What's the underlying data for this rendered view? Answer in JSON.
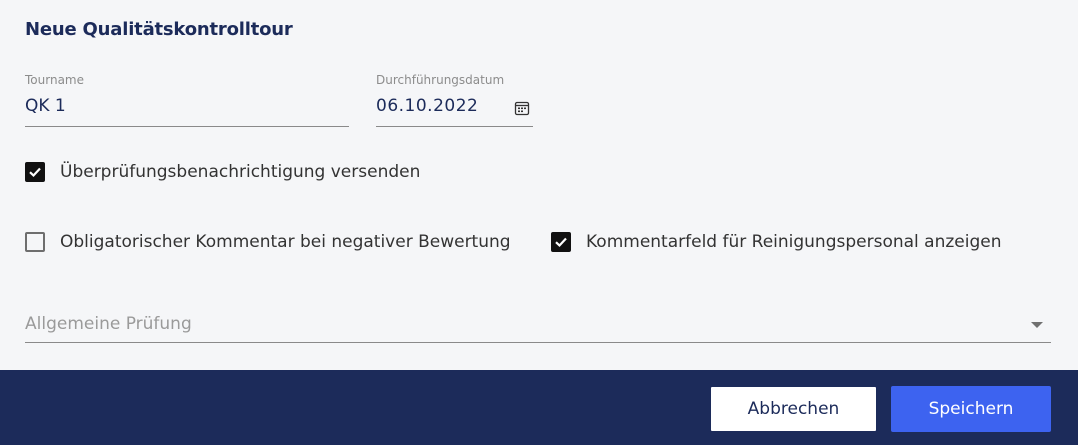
{
  "form": {
    "title": "Neue Qualitätskontrolltour",
    "tourname": {
      "label": "Tourname",
      "value": "QK 1"
    },
    "date": {
      "label": "Durchführungsdatum",
      "value": "06.10.2022",
      "icon": "calendar-icon"
    },
    "options": [
      {
        "label": "Überprüfungsbenachrichtigung versenden",
        "checked": true
      },
      {
        "label": "Obligatorischer Kommentar bei negativer Bewertung",
        "checked": false
      },
      {
        "label": "Kommentarfeld für Reinigungspersonal anzeigen",
        "checked": true
      }
    ],
    "inspection_select": {
      "placeholder": "Allgemeine Prüfung",
      "icon": "dropdown-caret-icon"
    }
  },
  "footer": {
    "cancel_label": "Abbrechen",
    "save_label": "Speichern"
  },
  "colors": {
    "background": "#f5f6f8",
    "primary_dark": "#1c2b5a",
    "accent_blue": "#3d63f0",
    "checkbox_checked": "#111111"
  }
}
